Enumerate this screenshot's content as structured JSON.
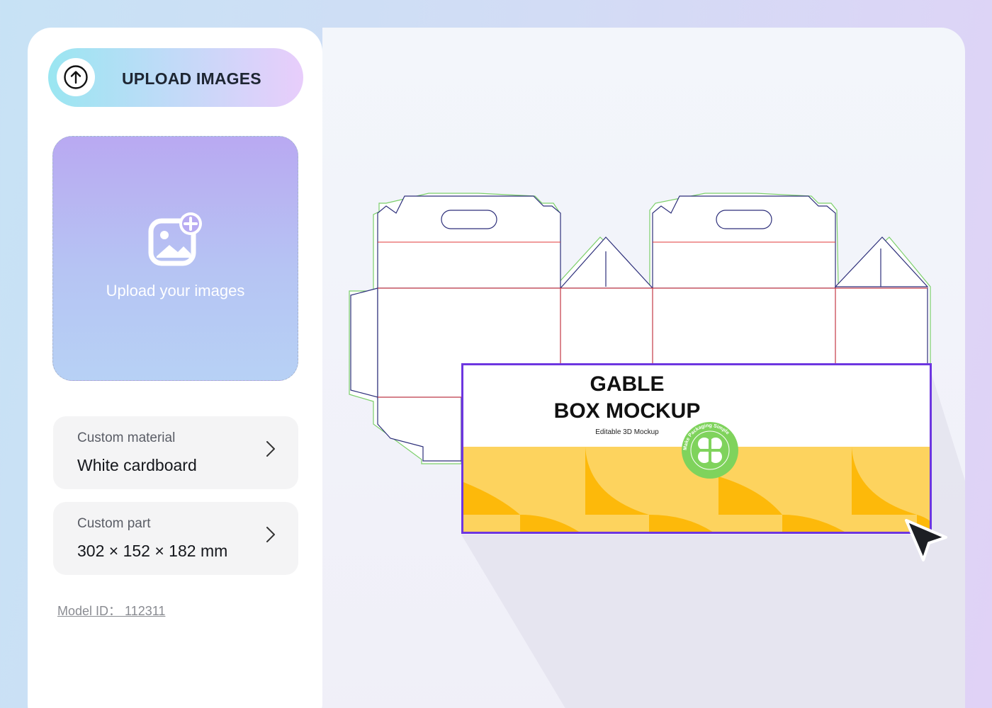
{
  "sidebar": {
    "upload_button": {
      "label": "UPLOAD IMAGES",
      "icon": "arrow-up-circle-icon"
    },
    "dropzone": {
      "label": "Upload your images",
      "icon": "add-image-icon"
    },
    "material": {
      "label": "Custom material",
      "value": "White cardboard"
    },
    "part": {
      "label": "Custom part",
      "value": "302 × 152 × 182 mm"
    },
    "model_id": "Model ID： 112311"
  },
  "mockup": {
    "title_line1": "GABLE",
    "title_line2": "BOX MOCKUP",
    "subtitle": "Editable 3D Mockup",
    "seal_text": "Make Packaging Simple",
    "colors": {
      "frame": "#6d36e0",
      "pattern_light": "#fdd35e",
      "pattern_dark": "#fdb90a",
      "seal": "#7fd35c"
    }
  }
}
